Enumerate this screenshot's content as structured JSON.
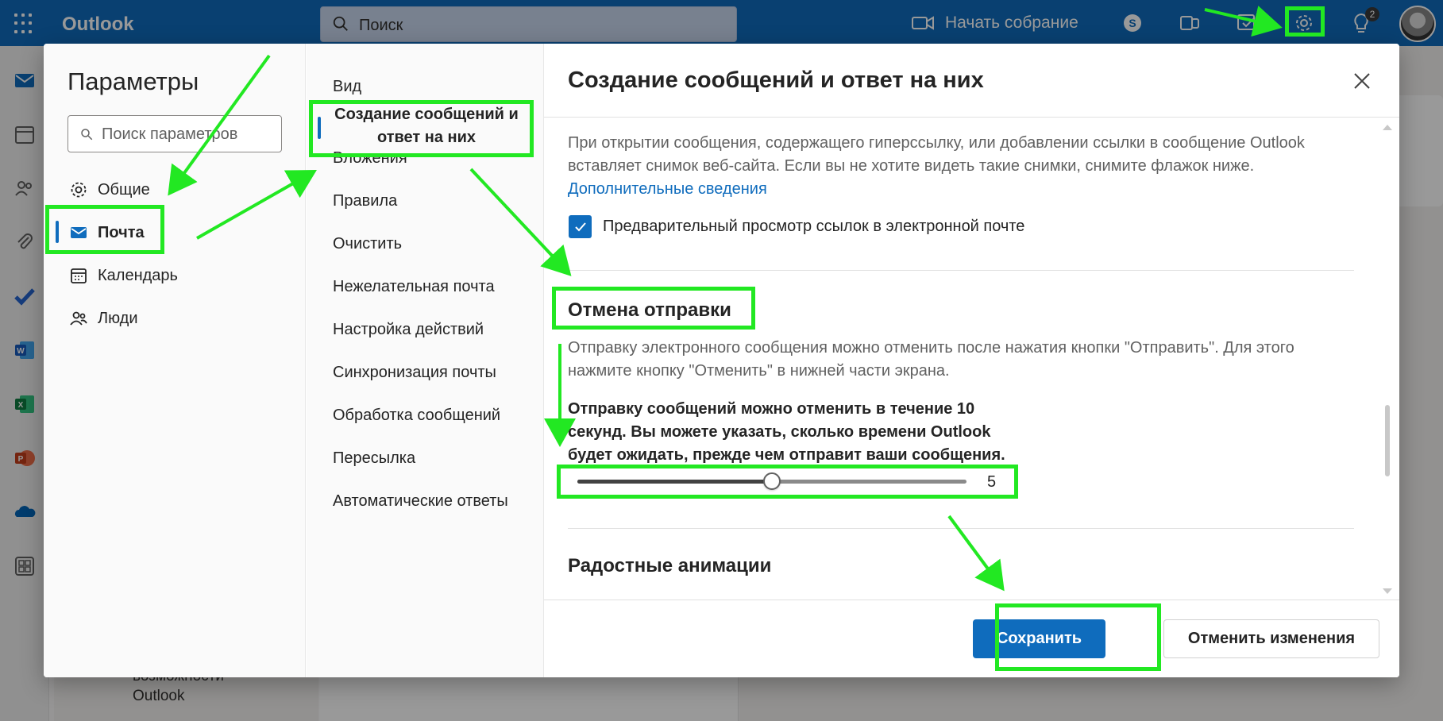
{
  "topbar": {
    "app_name": "Outlook",
    "search_placeholder": "Поиск",
    "meet_label": "Начать собрание",
    "notification_count": "2"
  },
  "background": {
    "feature_text": "возможности Outlook"
  },
  "settings": {
    "title": "Параметры",
    "search_placeholder": "Поиск параметров",
    "categories": [
      {
        "label": "Общие",
        "icon": "gear-icon"
      },
      {
        "label": "Почта",
        "icon": "mail-icon",
        "active": true
      },
      {
        "label": "Календарь",
        "icon": "calendar-icon"
      },
      {
        "label": "Люди",
        "icon": "people-icon"
      }
    ],
    "subcategories": [
      "Вид",
      "Создание сообщений и ответ на них",
      "Вложения",
      "Правила",
      "Очистить",
      "Нежелательная почта",
      "Настройка действий",
      "Синхронизация почты",
      "Обработка сообщений",
      "Пересылка",
      "Автоматические ответы"
    ],
    "active_subcategory_index": 1
  },
  "panel": {
    "title": "Создание сообщений и ответ на них",
    "link_preview": {
      "description": "При открытии сообщения, содержащего гиперссылку, или добавлении ссылки в сообщение Outlook вставляет снимок веб-сайта. Если вы не хотите видеть такие снимки, снимите флажок ниже.",
      "more_link": "Дополнительные сведения",
      "checkbox_label": "Предварительный просмотр ссылок в электронной почте",
      "checked": true
    },
    "undo_send": {
      "heading": "Отмена отправки",
      "description": "Отправку электронного сообщения можно отменить после нажатия кнопки \"Отправить\". Для этого нажмите кнопку \"Отменить\" в нижней части экрана.",
      "bold_text": "Отправку сообщений можно отменить в течение 10 секунд. Вы можете указать, сколько времени Outlook будет ожидать, прежде чем отправит ваши сообщения.",
      "slider_value": "5",
      "slider_min": 0,
      "slider_max": 10
    },
    "animations": {
      "heading": "Радостные анимации"
    }
  },
  "footer": {
    "save_label": "Сохранить",
    "cancel_label": "Отменить изменения"
  },
  "colors": {
    "accent": "#0f6cbd",
    "annotation": "#22e822"
  }
}
